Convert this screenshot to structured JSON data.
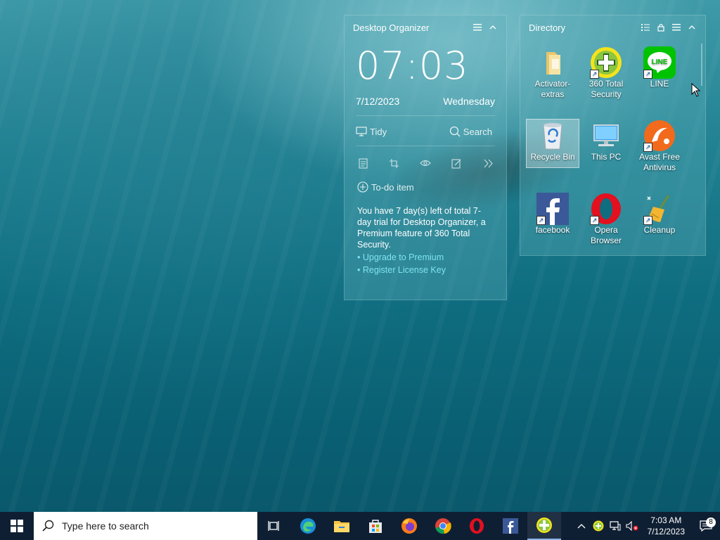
{
  "organizer": {
    "title": "Desktop Organizer",
    "time": "07:03",
    "date": "7/12/2023",
    "weekday": "Wednesday",
    "tidy_label": "Tidy",
    "search_label": "Search",
    "todo_label": "To-do item",
    "trial_text": "You have 7 day(s) left of total 7-day trial for Desktop Organizer, a Premium feature of 360 Total Security.",
    "upgrade_link": "• Upgrade to Premium",
    "register_link": "• Register License Key"
  },
  "directory": {
    "title": "Directory",
    "icons": [
      {
        "label": "Activator-extras",
        "icon": "folder-icon"
      },
      {
        "label": "360 Total Security",
        "icon": "360-security-icon"
      },
      {
        "label": "LINE",
        "icon": "line-icon"
      },
      {
        "label": "Recycle Bin",
        "icon": "recycle-bin-icon"
      },
      {
        "label": "This PC",
        "icon": "this-pc-icon"
      },
      {
        "label": "Avast Free Antivirus",
        "icon": "avast-icon"
      },
      {
        "label": "facebook",
        "icon": "facebook-icon"
      },
      {
        "label": "Opera Browser",
        "icon": "opera-icon"
      },
      {
        "label": "Cleanup",
        "icon": "cleanup-icon"
      }
    ]
  },
  "taskbar": {
    "search_placeholder": "Type here to search",
    "tray_time": "7:03 AM",
    "tray_date": "7/12/2023",
    "notification_count": "8"
  },
  "colors": {
    "link": "#7ee3ef",
    "taskbar": "#0f1f33"
  }
}
